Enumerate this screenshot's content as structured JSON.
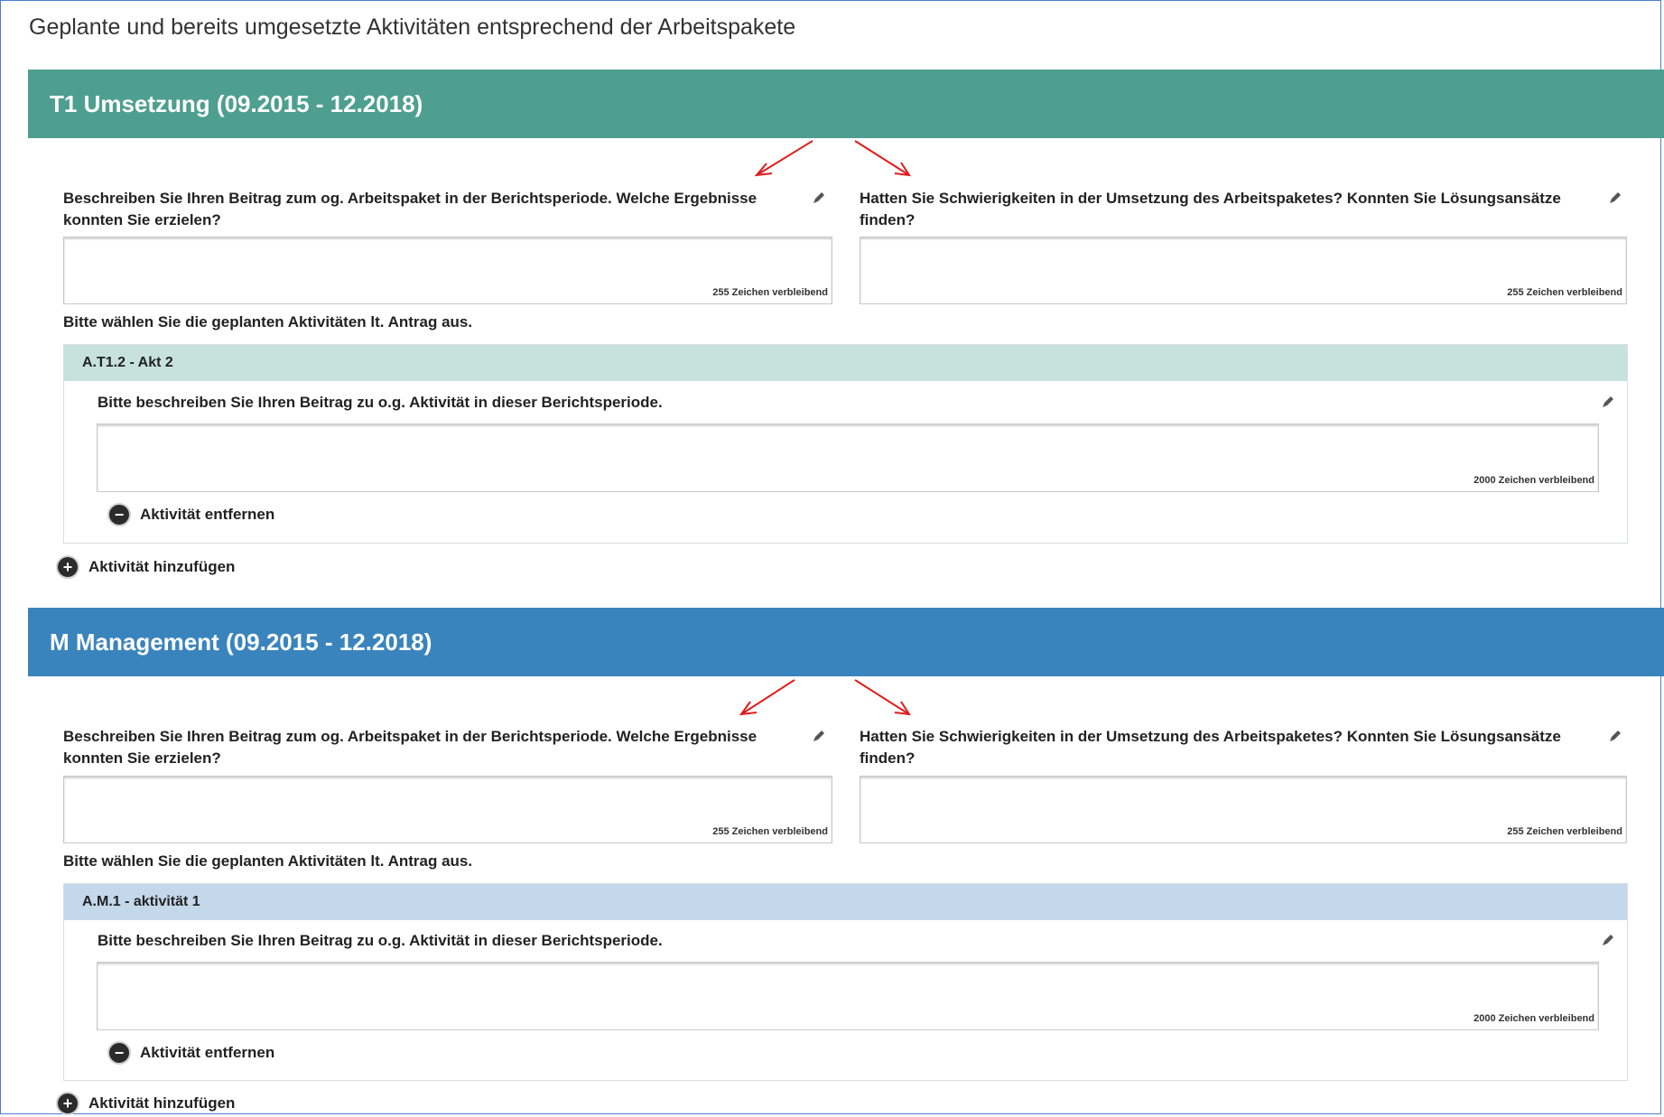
{
  "page_title": "Geplante und bereits umgesetzte Aktivitäten entsprechend der Arbeitspakete",
  "colors": {
    "t1_header": "#4e9f90",
    "t1_activity_header": "#c7e2dc",
    "m_header": "#3a84bd",
    "m_activity_header": "#c3d8ea",
    "annotation_arrow": "#e01b1b"
  },
  "sections": [
    {
      "title": "T1 Umsetzung (09.2015 - 12.2018)",
      "q1_label": "Beschreiben Sie Ihren Beitrag zum og. Arbeitspaket in der Berichtsperiode. Welche Ergebnisse konnten Sie erzielen?",
      "q1_counter": "255 Zeichen verbleibend",
      "q2_label": "Hatten Sie Schwierigkeiten in der Umsetzung des Arbeitspaketes? Konnten Sie Lösungsansätze finden?",
      "q2_counter": "255 Zeichen verbleibend",
      "instruction": "Bitte wählen Sie die geplanten Aktivitäten lt. Antrag aus.",
      "activity": {
        "title": "A.T1.2 - Akt 2",
        "label": "Bitte beschreiben Sie Ihren Beitrag zu o.g. Aktivität in dieser Berichtsperiode.",
        "counter": "2000 Zeichen verbleibend",
        "remove_label": "Aktivität entfernen"
      },
      "add_label": "Aktivität hinzufügen"
    },
    {
      "title": "M Management (09.2015 - 12.2018)",
      "q1_label": "Beschreiben Sie Ihren Beitrag zum og. Arbeitspaket in der Berichtsperiode. Welche Ergebnisse konnten Sie erzielen?",
      "q1_counter": "255 Zeichen verbleibend",
      "q2_label": "Hatten Sie Schwierigkeiten in der Umsetzung des Arbeitspaketes? Konnten Sie Lösungsansätze finden?",
      "q2_counter": "255 Zeichen verbleibend",
      "instruction": "Bitte wählen Sie die geplanten Aktivitäten lt. Antrag aus.",
      "activity": {
        "title": "A.M.1 - aktivität 1",
        "label": "Bitte beschreiben Sie Ihren Beitrag zu o.g. Aktivität in dieser Berichtsperiode.",
        "counter": "2000 Zeichen verbleibend",
        "remove_label": "Aktivität entfernen"
      },
      "add_label": "Aktivität hinzufügen"
    }
  ]
}
